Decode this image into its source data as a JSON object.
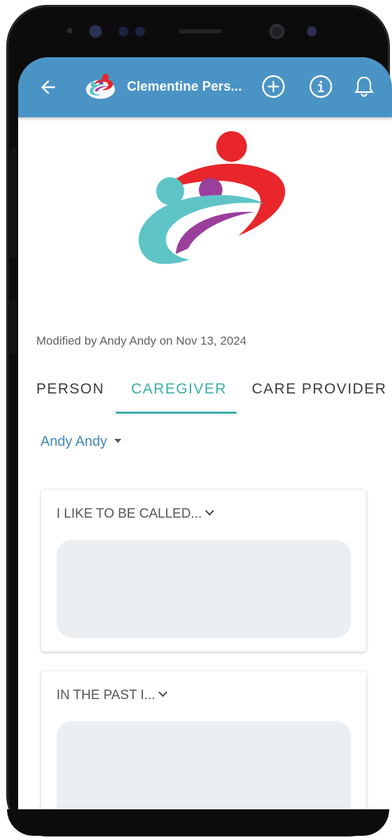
{
  "app_bar": {
    "title": "Clementine Pers...",
    "back_icon": "arrow-left-icon",
    "add_icon": "plus-circle-icon",
    "info_icon": "info-circle-icon",
    "bell_icon": "bell-icon",
    "background_color": "#4a93c5"
  },
  "logo": {
    "colors": {
      "red": "#e8262b",
      "teal": "#5fc4c6",
      "purple": "#9b3f9c"
    }
  },
  "modified_text": "Modified by Andy Andy on Nov 13, 2024",
  "tabs": [
    {
      "label": "PERSON",
      "active": false
    },
    {
      "label": "CAREGIVER",
      "active": true
    },
    {
      "label": "CARE PROVIDER",
      "active": false
    }
  ],
  "accent_color": "#3aaeaa",
  "selector": {
    "value": "Andy Andy"
  },
  "cards": [
    {
      "title": "I LIKE TO BE CALLED...",
      "value": ""
    },
    {
      "title": "IN THE PAST I...",
      "value": ""
    }
  ]
}
